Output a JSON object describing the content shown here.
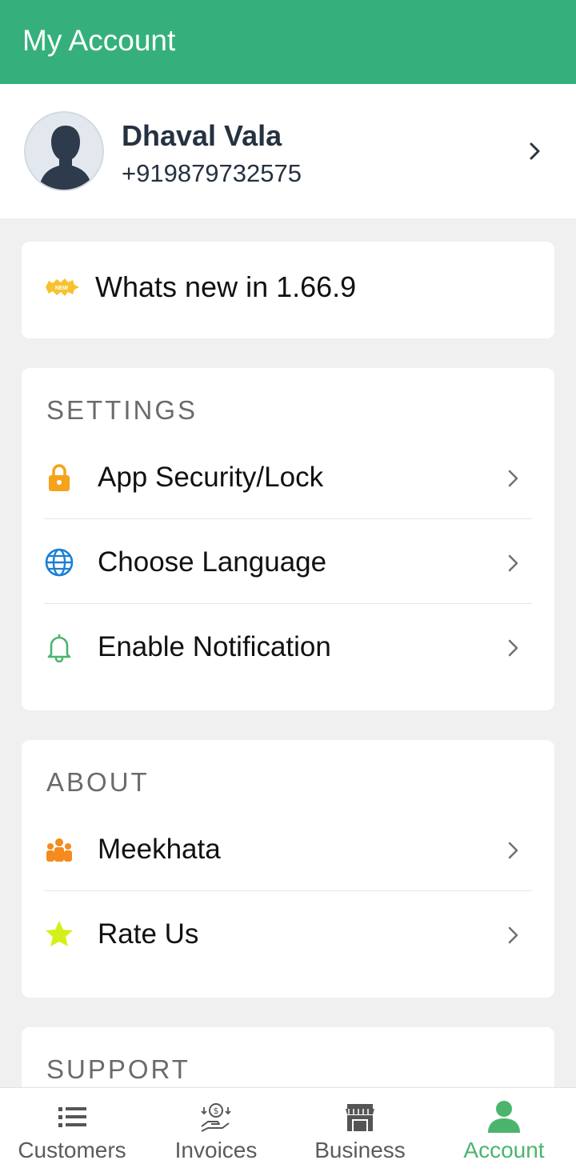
{
  "header": {
    "title": "My Account"
  },
  "profile": {
    "name": "Dhaval Vala",
    "phone": "+919879732575"
  },
  "whats_new": {
    "badge": "NEW",
    "label": "Whats new in 1.66.9"
  },
  "settings": {
    "title": "SETTINGS",
    "items": [
      {
        "label": "App Security/Lock",
        "icon": "lock-icon",
        "color": "#f5a31a"
      },
      {
        "label": "Choose Language",
        "icon": "globe-icon",
        "color": "#1a7fd6"
      },
      {
        "label": "Enable Notification",
        "icon": "bell-icon",
        "color": "#4bb56d"
      }
    ]
  },
  "about": {
    "title": "ABOUT",
    "items": [
      {
        "label": "Meekhata",
        "icon": "group-icon",
        "color": "#f58a1f"
      },
      {
        "label": "Rate Us",
        "icon": "star-icon",
        "color": "#d4f01a"
      }
    ]
  },
  "support": {
    "title": "SUPPORT"
  },
  "bottom_nav": {
    "active": "Account",
    "items": [
      {
        "label": "Customers",
        "icon": "list-icon"
      },
      {
        "label": "Invoices",
        "icon": "money-hand-icon"
      },
      {
        "label": "Business",
        "icon": "store-icon"
      },
      {
        "label": "Account",
        "icon": "user-icon"
      }
    ]
  },
  "colors": {
    "primary": "#35b07d",
    "active_nav": "#4bb56d",
    "background": "#f0f0f0"
  }
}
